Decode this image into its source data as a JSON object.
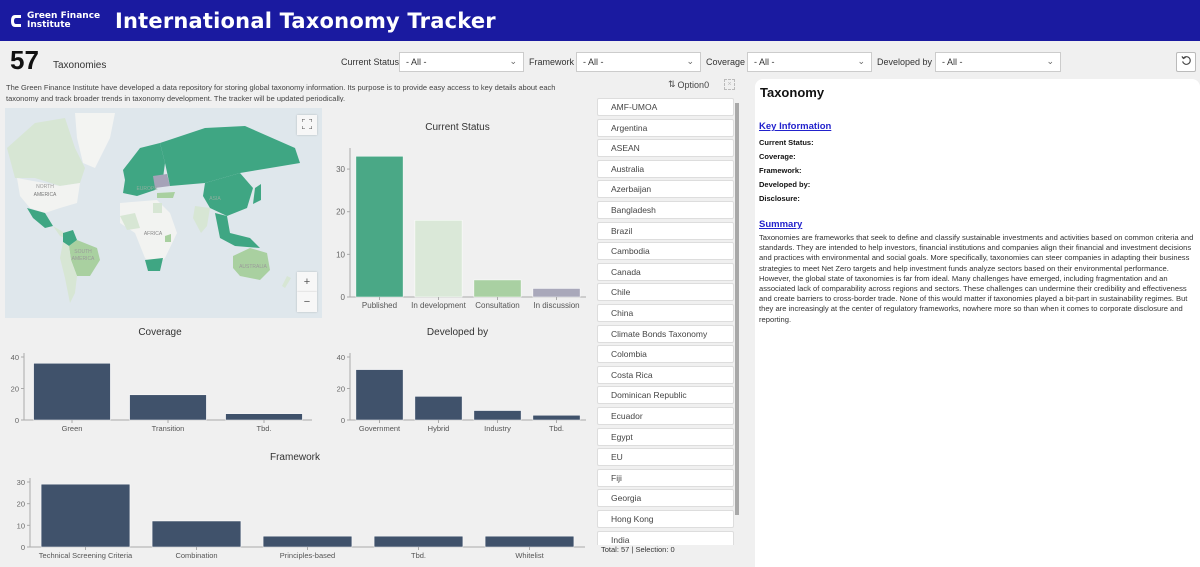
{
  "header": {
    "logo_line1": "Green Finance",
    "logo_line2": "Institute",
    "title": "International Taxonomy Tracker",
    "brand_color": "#1a1aa0"
  },
  "summary_count": {
    "value": "57",
    "label": "Taxonomies"
  },
  "filters": [
    {
      "label": "Current Status",
      "value": "- All -"
    },
    {
      "label": "Framework",
      "value": "- All -"
    },
    {
      "label": "Coverage",
      "value": "- All -"
    },
    {
      "label": "Developed by",
      "value": "- All -"
    }
  ],
  "reset_icon": "reset-icon",
  "intro": "The Green Finance Institute have developed a data repository for storing global taxonomy information. Its purpose is to provide easy access to key details about each taxonomy and track broader trends in taxonomy development. The tracker will be updated periodically.",
  "map": {
    "labels": [
      "NORTH",
      "AMERICA",
      "EUROPE",
      "ASIA",
      "AFRICA",
      "SOUTH",
      "AMERICA",
      "AUSTRALIA"
    ],
    "zoom_in": "+",
    "zoom_out": "−",
    "colors": {
      "published": "#3fa683",
      "in_development": "#d8e8d6",
      "consultation": "#a9d0a0",
      "in_discussion": "#a5a3b8"
    }
  },
  "list": {
    "sort_label": "Option0",
    "items": [
      "AMF-UMOA",
      "Argentina",
      "ASEAN",
      "Australia",
      "Azerbaijan",
      "Bangladesh",
      "Brazil",
      "Cambodia",
      "Canada",
      "Chile",
      "China",
      "Climate Bonds Taxonomy",
      "Colombia",
      "Costa Rica",
      "Dominican Republic",
      "Ecuador",
      "Egypt",
      "EU",
      "Fiji",
      "Georgia",
      "Hong Kong",
      "India"
    ],
    "footer": "Total: 57 | Selection: 0"
  },
  "detail": {
    "title": "Taxonomy",
    "key_info_heading": "Key Information",
    "fields": [
      "Current Status:",
      "Coverage:",
      "Framework:",
      "Developed by:",
      "Disclosure:"
    ],
    "summary_heading": "Summary",
    "summary_text": "Taxonomies are frameworks that seek to define and classify sustainable investments and activities based on common criteria and standards. They are intended to help investors, financial institutions and companies align their financial and investment decisions and practices with environmental and social goals. More specifically, taxonomies can steer companies in adapting their business strategies to meet Net Zero targets and help investment funds analyze sectors based on their environmental performance.  However, the global state of taxonomies is far from ideal. Many challenges have emerged, including fragmentation and an associated lack of comparability across regions and sectors. These challenges can undermine their credibility and effectiveness and create barriers to cross-border trade. None of this would matter if taxonomies played a bit-part in sustainability regimes. But they are increasingly at the center of regulatory frameworks, nowhere more so than when it comes to corporate disclosure and reporting."
  },
  "chart_data": [
    {
      "id": "status",
      "type": "bar",
      "title": "Current Status",
      "categories": [
        "Published",
        "In development",
        "Consultation",
        "In discussion"
      ],
      "values": [
        33,
        18,
        4,
        2
      ],
      "colors": [
        "#4aa886",
        "#dae8d8",
        "#a9d0a2",
        "#a9a8ba"
      ],
      "yticks": [
        0,
        10,
        20,
        30
      ],
      "ylim": [
        0,
        34
      ],
      "xlabel": "",
      "ylabel": "",
      "grid": false
    },
    {
      "id": "coverage",
      "type": "bar",
      "title": "Coverage",
      "categories": [
        "Green",
        "Transition",
        "Tbd."
      ],
      "values": [
        36,
        16,
        4
      ],
      "colors": [
        "#40526b"
      ],
      "yticks": [
        0,
        20,
        40
      ],
      "ylim": [
        0,
        40
      ],
      "xlabel": "",
      "ylabel": "",
      "grid": false
    },
    {
      "id": "developed",
      "type": "bar",
      "title": "Developed by",
      "categories": [
        "Government",
        "Hybrid",
        "Industry",
        "Tbd."
      ],
      "values": [
        32,
        15,
        6,
        3
      ],
      "colors": [
        "#40526b"
      ],
      "yticks": [
        0,
        20,
        40
      ],
      "ylim": [
        0,
        40
      ],
      "xlabel": "",
      "ylabel": "",
      "grid": false
    },
    {
      "id": "framework",
      "type": "bar",
      "title": "Framework",
      "categories": [
        "Technical Screening Criteria",
        "Combination",
        "Principles-based",
        "Tbd.",
        "Whitelist"
      ],
      "values": [
        29,
        12,
        5,
        5,
        5
      ],
      "colors": [
        "#40526b"
      ],
      "yticks": [
        0,
        10,
        20,
        30
      ],
      "ylim": [
        0,
        30
      ],
      "xlabel": "",
      "ylabel": "",
      "grid": false
    }
  ]
}
